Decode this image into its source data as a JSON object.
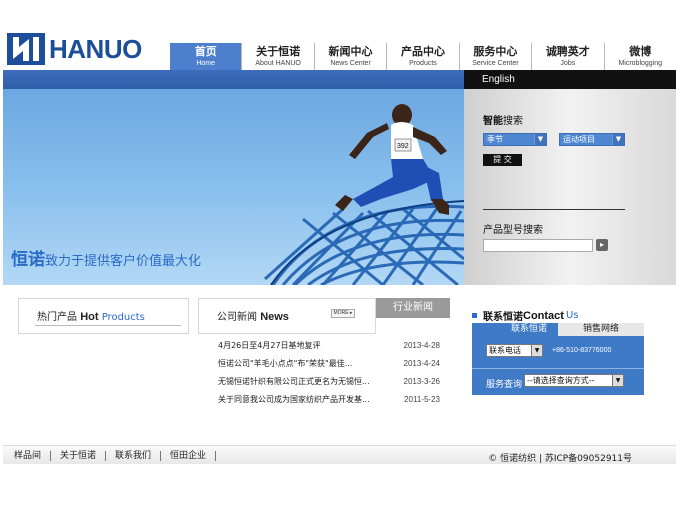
{
  "brand": {
    "name": "HANUO",
    "color": "#1d4e9a"
  },
  "nav": [
    {
      "zh": "首页",
      "en": "Home",
      "active": true
    },
    {
      "zh": "关于恒诺",
      "en": "About HANUO"
    },
    {
      "zh": "新闻中心",
      "en": "News Center"
    },
    {
      "zh": "产品中心",
      "en": "Products"
    },
    {
      "zh": "服务中心",
      "en": "Service Center"
    },
    {
      "zh": "诚聘英才",
      "en": "Jobs"
    },
    {
      "zh": "微博",
      "en": "Microblogging"
    }
  ],
  "language_link": "English",
  "banner": {
    "slogan_big": "恒诺",
    "slogan_rest": "致力于提供客户价值最大化"
  },
  "smart_search": {
    "title_bold": "智能",
    "title_rest": "搜索",
    "season_select": "季节",
    "activity_select": "运动项目",
    "submit_label": "提 交",
    "model_search_title": "产品型号搜索",
    "model_input_value": ""
  },
  "hot_products": {
    "title_zh": "热门产品",
    "title_en_bold": "Hot",
    "title_en_blue": "Products"
  },
  "news": {
    "title_zh": "公司新闻",
    "title_en": "News",
    "more_label": "MORE ▸",
    "industry_tab": "行业新闻",
    "items": [
      {
        "title": "4月26日至4月27日基地复评",
        "date": "2013-4-28"
      },
      {
        "title": "恒诺公司\"羊毛小点点\"布\"荣获\"最佳...",
        "date": "2013-4-24"
      },
      {
        "title": "无锡恒诺针织有限公司正式更名为无锡恒...",
        "date": "2013-3-26"
      },
      {
        "title": "关于同意我公司成为国家纺织产品开发基...",
        "date": "2011-5-23"
      }
    ]
  },
  "contact": {
    "title_zh": "联系恒诺",
    "title_en_bold": "Contact",
    "title_en_blue": "Us",
    "tab_contact": "联系恒诺",
    "tab_sales": "销售网络",
    "phone_select": "联系电话",
    "phone_value": "+86-510-83776000",
    "service_label": "服务查询",
    "service_select": "--请选择查询方式--"
  },
  "footer": {
    "links": [
      "样品间",
      "关于恒诺",
      "联系我们",
      "恒田企业"
    ],
    "copyright": "© 恒诺纺织  |  苏ICP备09052911号"
  },
  "colors": {
    "primary_blue": "#3f7ac6",
    "accent_blue": "#2a6bc7",
    "dark": "#111111"
  }
}
